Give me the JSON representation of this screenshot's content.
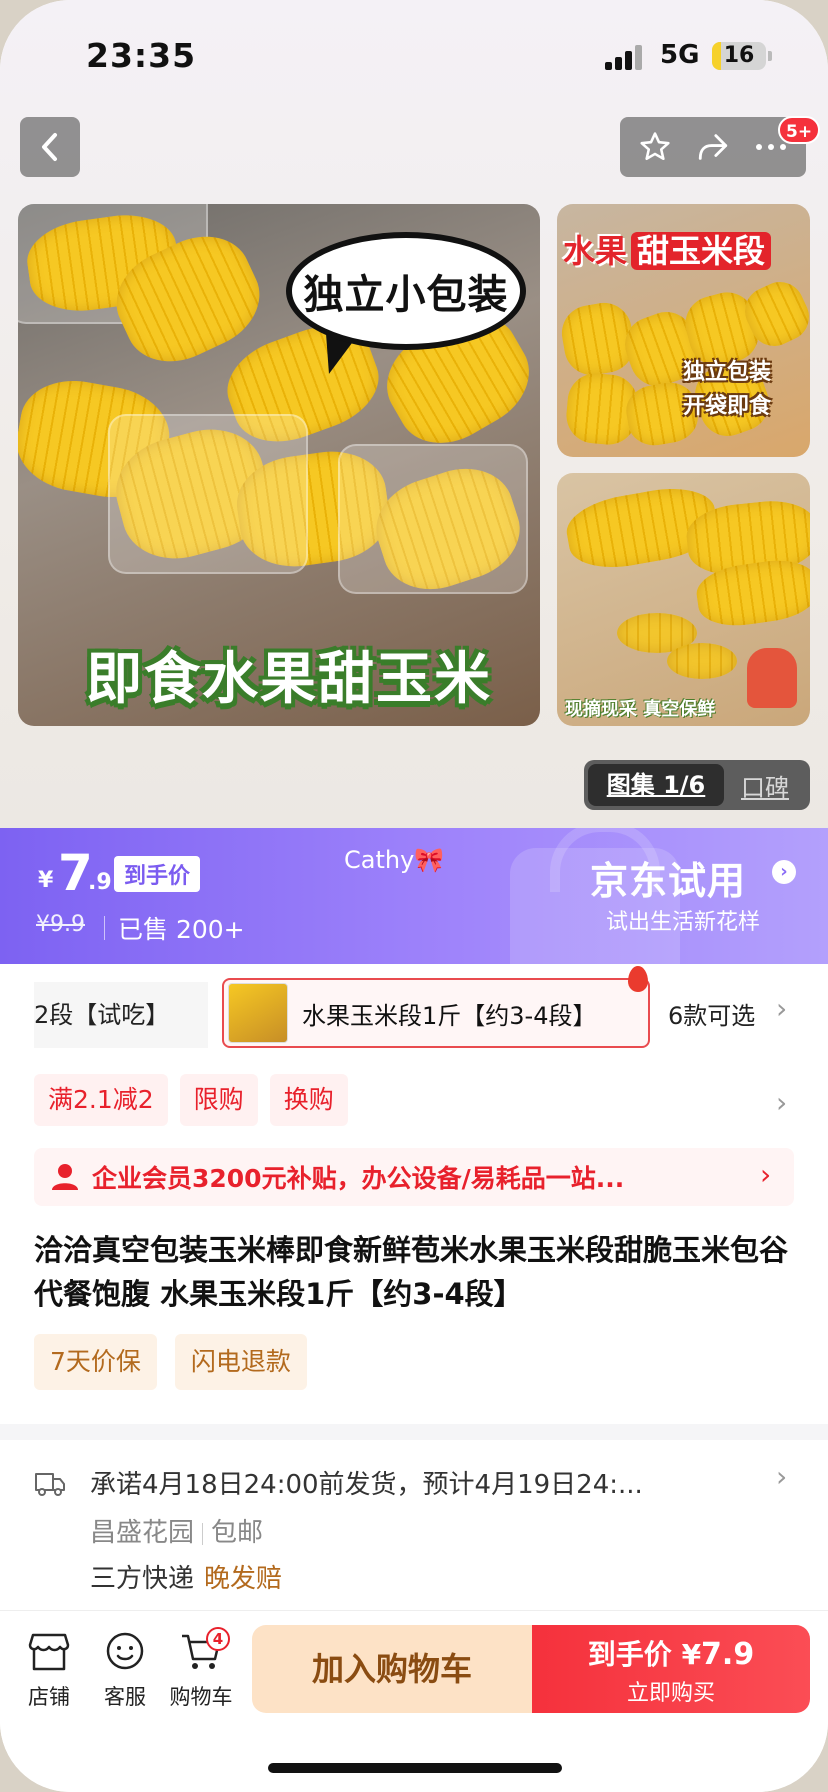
{
  "status_bar": {
    "time": "23:35",
    "network": "5G",
    "battery": "16",
    "battery_level": 0.16
  },
  "nav": {
    "cart_badge": "5+"
  },
  "gallery": {
    "main_bubble": "独立小包装",
    "main_caption": "即食水果甜玉米",
    "side1_title_a": "水果",
    "side1_title_b": "甜玉米段",
    "side1_tag1": "独立包装",
    "side1_tag2": "开袋即食",
    "side2_caption": "现摘现采 真空保鲜",
    "switch_active": "图集 1/6",
    "switch_inactive": "口碑"
  },
  "price": {
    "yen": "¥",
    "integer": "7",
    "decimal": ".9",
    "tag": "到手价",
    "original": "¥9.9",
    "sold": "已售 200+",
    "user": "Cathy🎀",
    "promo_title": "京东试用",
    "promo_subtitle": "试出生活新花样"
  },
  "variant": {
    "prev_label": "2段【试吃】",
    "current_label": "水果玉米段1斤【约3-4段】",
    "more_label": "6款可选"
  },
  "promotions": [
    "满2.1减2",
    "限购",
    "换购"
  ],
  "enterprise": "企业会员3200元补贴，办公设备/易耗品一站...",
  "title": "洽洽真空包装玉米棒即食新鲜苞米水果玉米段甜脆玉米包谷代餐饱腹 水果玉米段1斤【约3-4段】",
  "guarantees": [
    "7天价保",
    "闪电退款"
  ],
  "shipping": {
    "line1": "承诺4月18日24:00前发货，预计4月19日24:...",
    "location": "昌盛花园",
    "free": "包邮",
    "courier": "三方快递",
    "late_comp": "晚发赔"
  },
  "bottom_bar": {
    "store": "店铺",
    "service": "客服",
    "cart": "购物车",
    "cart_count": "4",
    "add_cart": "加入购物车",
    "buy_price_label": "到手价",
    "buy_price_yen": "¥",
    "buy_price": "7.9",
    "buy_now": "立即购买"
  },
  "colors": {
    "accent_red": "#f5313c",
    "purple": "#8a6cf6",
    "orange_text": "#b36a1e"
  }
}
